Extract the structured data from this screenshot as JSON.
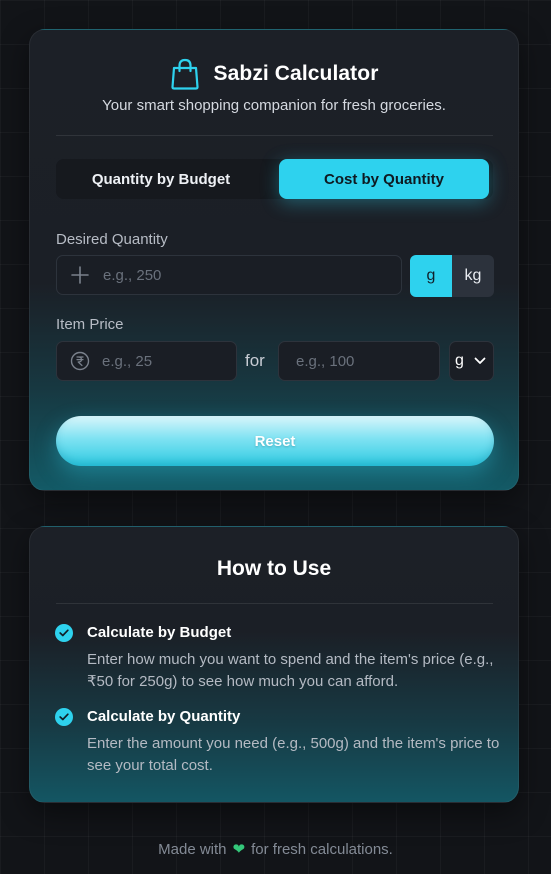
{
  "app": {
    "title": "Sabzi Calculator",
    "subtitle": "Your smart shopping companion for fresh groceries.",
    "icon": "shopping-bag-icon",
    "accent_color": "#2ed2ee"
  },
  "tabs": [
    {
      "label": "Quantity by Budget",
      "active": false
    },
    {
      "label": "Cost by Quantity",
      "active": true
    }
  ],
  "desired_quantity": {
    "label": "Desired Quantity",
    "placeholder": "e.g., 250",
    "value": "",
    "icon": "plus-icon",
    "units": [
      {
        "label": "g",
        "selected": true
      },
      {
        "label": "kg",
        "selected": false
      }
    ]
  },
  "item_price": {
    "label": "Item Price",
    "price_placeholder": "e.g., 25",
    "price_icon": "rupee-icon",
    "for_text": "for",
    "amount_placeholder": "e.g., 100",
    "unit_selected": "g"
  },
  "reset_label": "Reset",
  "how_to_use": {
    "title": "How to Use",
    "steps": [
      {
        "title": "Calculate by Budget",
        "description": "Enter how much you want to spend and the item's price (e.g., ₹50 for 250g) to see how much you can afford."
      },
      {
        "title": "Calculate by Quantity",
        "description": "Enter the amount you need (e.g., 500g) and the item's price to see your total cost."
      }
    ]
  },
  "footer": {
    "prefix": "Made with",
    "heart_icon": "heart-icon",
    "suffix": "for fresh calculations."
  }
}
